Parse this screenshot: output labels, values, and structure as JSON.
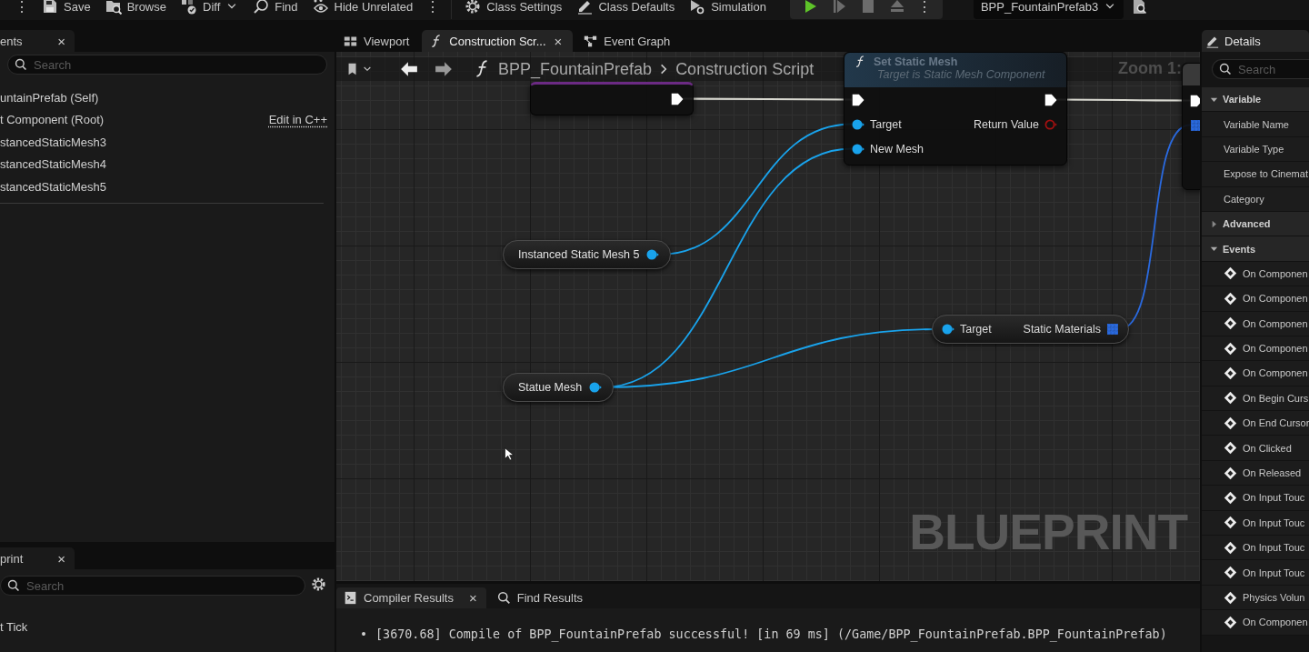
{
  "toolbar": [
    {
      "kind": "more",
      "label": "⋮"
    },
    {
      "kind": "button",
      "label": "Save"
    },
    {
      "kind": "button",
      "label": "Browse"
    },
    {
      "kind": "dropdown",
      "label": "Diff"
    },
    {
      "kind": "button",
      "label": "Find"
    },
    {
      "kind": "button",
      "label": "Hide Unrelated"
    },
    {
      "kind": "more",
      "label": "⋮"
    },
    {
      "kind": "button",
      "label": "Class Settings"
    },
    {
      "kind": "button",
      "label": "Class Defaults"
    },
    {
      "kind": "button",
      "label": "Simulation"
    },
    {
      "kind": "play",
      "disabled": false
    },
    {
      "kind": "step",
      "disabled": true
    },
    {
      "kind": "stop",
      "disabled": true
    },
    {
      "kind": "eject",
      "disabled": true
    },
    {
      "kind": "more",
      "label": "⋮"
    },
    {
      "kind": "combo",
      "label": "BPP_FountainPrefab3"
    },
    {
      "kind": "icon"
    }
  ],
  "components_panel": {
    "tab": {
      "label": "ents",
      "close": "×",
      "selected": true
    },
    "search": {
      "placeholder": "Search"
    },
    "items": [
      {
        "label": "untainPrefab (Self)"
      },
      {
        "label": "t Component (Root)",
        "link": "Edit in C++"
      },
      {
        "label": "stancedStaticMesh3"
      },
      {
        "label": "stancedStaticMesh4"
      },
      {
        "label": "stancedStaticMesh5"
      }
    ]
  },
  "blueprint_panel": {
    "tab": {
      "label": "print",
      "close": "×",
      "selected": true
    },
    "search": {
      "placeholder": "Search"
    },
    "items": [
      {
        "label": "t Tick"
      }
    ]
  },
  "editor_tabs": [
    {
      "label": "Viewport",
      "selected": false
    },
    {
      "label": "Construction Scr...",
      "selected": true,
      "close": "×"
    },
    {
      "label": "Event Graph",
      "selected": false
    }
  ],
  "graph": {
    "breadcrumb": [
      "BPP_FountainPrefab",
      "Construction Script"
    ],
    "zoom": "Zoom 1:",
    "watermark": "BLUEPRINT",
    "nodes": [
      {
        "kind": "entry",
        "outputs": [
          {
            "kind": "exec",
            "color": "#ffffff",
            "connected": true
          }
        ]
      },
      {
        "kind": "function",
        "title": "Set Static Mesh",
        "subtitle": "Target is Static Mesh Component",
        "inputs": [
          {
            "kind": "exec",
            "color": "#ffffff",
            "connected": true
          },
          {
            "kind": "object",
            "label": "Target",
            "color": "#19a3ec",
            "connected": true
          },
          {
            "kind": "object",
            "label": "New Mesh",
            "color": "#19a3ec",
            "connected": true
          }
        ],
        "outputs": [
          {
            "kind": "exec",
            "color": "#ffffff",
            "connected": true
          },
          {
            "kind": "object",
            "label": "Return Value",
            "color": "#a01010",
            "connected": false
          }
        ]
      },
      {
        "kind": "partial",
        "inputs": [
          {
            "kind": "exec",
            "color": "#ffffff",
            "connected": true
          },
          {
            "kind": "array",
            "color": "#2a6ae0",
            "connected": true
          }
        ]
      },
      {
        "kind": "variable",
        "label": "Instanced Static Mesh 5",
        "outputs": [
          {
            "kind": "object",
            "color": "#19a3ec",
            "connected": true
          }
        ]
      },
      {
        "kind": "variable",
        "label": "Statue Mesh",
        "outputs": [
          {
            "kind": "object",
            "color": "#19a3ec",
            "connected": true
          }
        ]
      },
      {
        "kind": "pure",
        "inputs": [
          {
            "kind": "object",
            "label": "Target",
            "color": "#19a3ec",
            "connected": true
          }
        ],
        "outputs": [
          {
            "kind": "array",
            "label": "Static Materials",
            "color": "#2a6ae0",
            "connected": true
          }
        ]
      }
    ]
  },
  "bottom_panel": {
    "tabs": [
      {
        "label": "Compiler Results",
        "selected": true,
        "close": "×"
      },
      {
        "label": "Find Results",
        "selected": false
      }
    ],
    "messages": [
      {
        "bullet": "•",
        "text": "[3670.68] Compile of BPP_FountainPrefab successful! [in 69 ms] (/Game/BPP_FountainPrefab.BPP_FountainPrefab)"
      }
    ]
  },
  "details": {
    "tab": {
      "label": "Details",
      "selected": true
    },
    "search": {
      "placeholder": "Search"
    },
    "sections": [
      {
        "label": "Variable",
        "expanded": true,
        "rows": [
          {
            "kind": "property",
            "label": "Variable Name"
          },
          {
            "kind": "property",
            "label": "Variable Type"
          },
          {
            "kind": "property",
            "label": "Expose to Cinemat"
          },
          {
            "kind": "property",
            "label": "Category"
          }
        ]
      },
      {
        "label": "Advanced",
        "expanded": false
      },
      {
        "label": "Events",
        "expanded": true,
        "rows": [
          {
            "kind": "event",
            "label": "On Componen"
          },
          {
            "kind": "event",
            "label": "On Componen"
          },
          {
            "kind": "event",
            "label": "On Componen"
          },
          {
            "kind": "event",
            "label": "On Componen"
          },
          {
            "kind": "event",
            "label": "On Componen"
          },
          {
            "kind": "event",
            "label": "On Begin Curs"
          },
          {
            "kind": "event",
            "label": "On End Cursor"
          },
          {
            "kind": "event",
            "label": "On Clicked"
          },
          {
            "kind": "event",
            "label": "On Released"
          },
          {
            "kind": "event",
            "label": "On Input Touc"
          },
          {
            "kind": "event",
            "label": "On Input Touc"
          },
          {
            "kind": "event",
            "label": "On Input Touc"
          },
          {
            "kind": "event",
            "label": "On Input Touc"
          },
          {
            "kind": "event",
            "label": "Physics Volun"
          },
          {
            "kind": "event",
            "label": "On Componen"
          }
        ]
      }
    ]
  }
}
